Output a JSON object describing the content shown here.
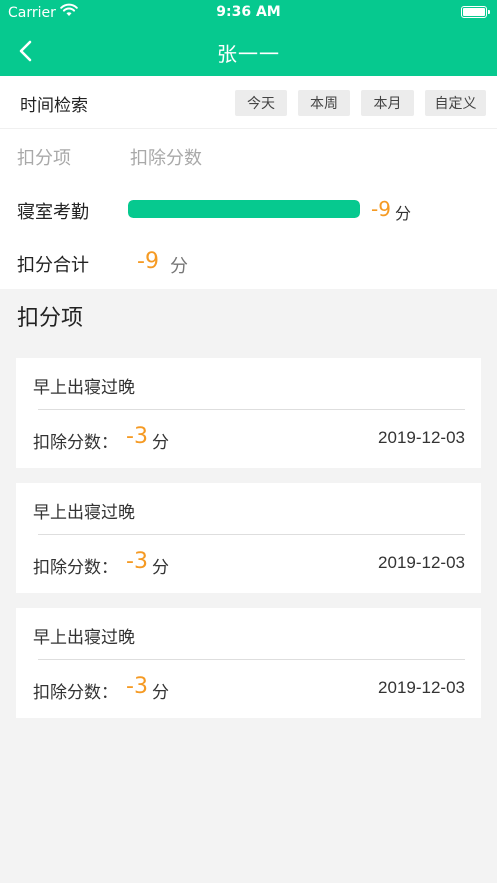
{
  "status_bar": {
    "carrier": "Carrier",
    "time": "9:36 AM"
  },
  "nav": {
    "title": "张一一",
    "back_icon": "chevron-left-icon"
  },
  "filter": {
    "label": "时间检索",
    "options": [
      "今天",
      "本周",
      "本月",
      "自定义"
    ]
  },
  "summary": {
    "header_item": "扣分项",
    "header_score": "扣除分数",
    "categories": [
      {
        "name": "寝室考勤",
        "value": "-9",
        "unit": "分",
        "fraction": 1.0
      }
    ],
    "total_label": "扣分合计",
    "total_value": "-9",
    "total_unit": "分"
  },
  "section_title": "扣分项",
  "records": [
    {
      "title": "早上出寝过晚",
      "label": "扣除分数：",
      "value": "-3",
      "unit": "分",
      "date": "2019-12-03"
    },
    {
      "title": "早上出寝过晚",
      "label": "扣除分数：",
      "value": "-3",
      "unit": "分",
      "date": "2019-12-03"
    },
    {
      "title": "早上出寝过晚",
      "label": "扣除分数：",
      "value": "-3",
      "unit": "分",
      "date": "2019-12-03"
    }
  ],
  "colors": {
    "primary": "#06c98f",
    "accent": "#f59a23"
  }
}
